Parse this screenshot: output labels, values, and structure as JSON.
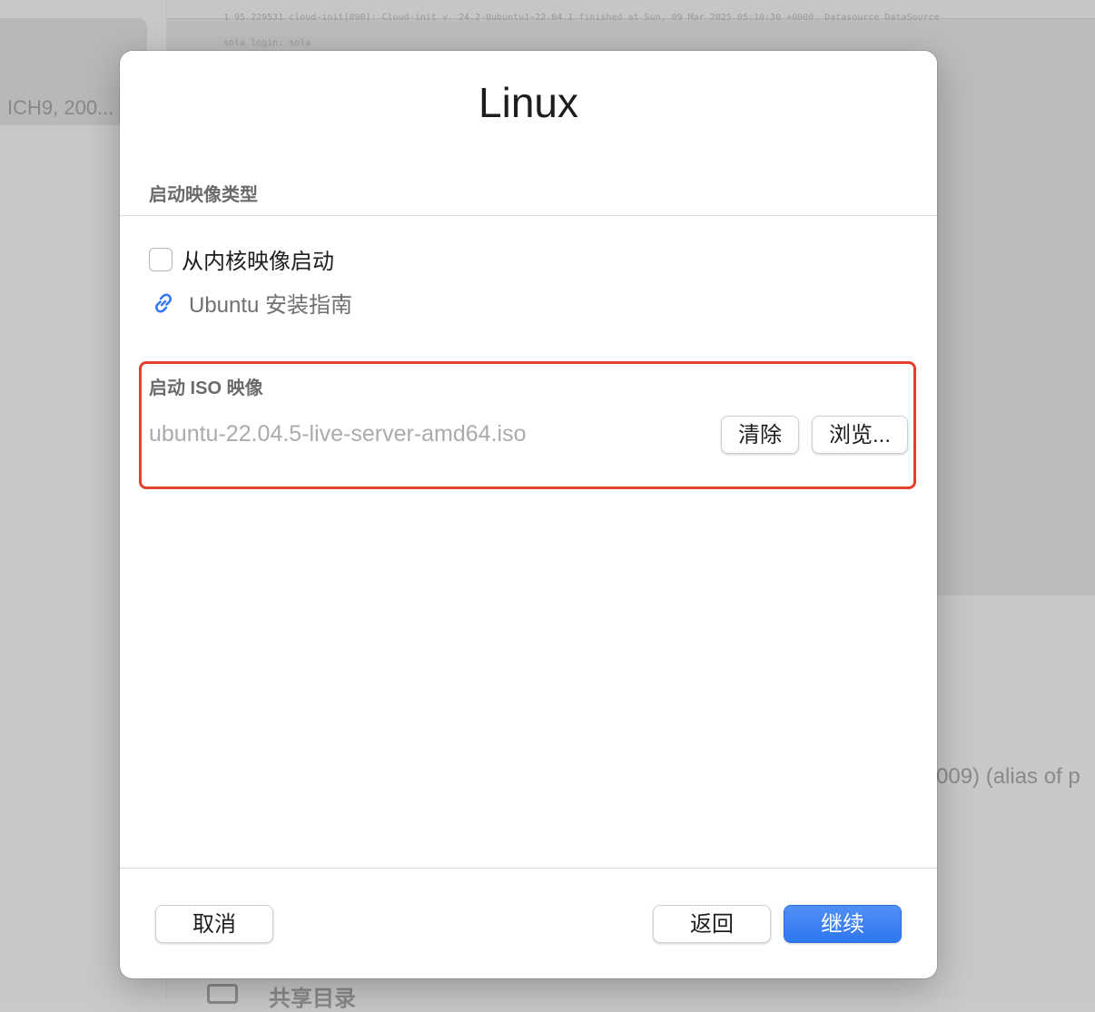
{
  "background": {
    "sidebar_item_text": "ICH9, 200...",
    "console_lines": [
      "1  95.229531  cloud-init[890]: Cloud-init v. 24.2-0ubuntu1~22.04.1 finished at Sun, 09 Mar 2025 05:10:30 +0000. Datasource DataSource",
      "sola login: sola"
    ],
    "alias_text": "009) (alias of p",
    "shared_folder_label": "共享目录"
  },
  "dialog": {
    "title": "Linux",
    "boot_type_header": "启动映像类型",
    "kernel_boot_checkbox": {
      "label": "从内核映像启动",
      "checked": false
    },
    "install_guide_link": "Ubuntu 安装指南",
    "iso": {
      "header": "启动 ISO 映像",
      "path": "ubuntu-22.04.5-live-server-amd64.iso",
      "clear_label": "清除",
      "browse_label": "浏览..."
    },
    "footer": {
      "cancel_label": "取消",
      "back_label": "返回",
      "continue_label": "继续"
    }
  },
  "colors": {
    "accent": "#2f77ee",
    "highlight_border": "#e2412e",
    "link_icon": "#3478f6"
  },
  "icons": {
    "link": "link-chain-icon",
    "shared_folder": "folder-share-icon"
  }
}
